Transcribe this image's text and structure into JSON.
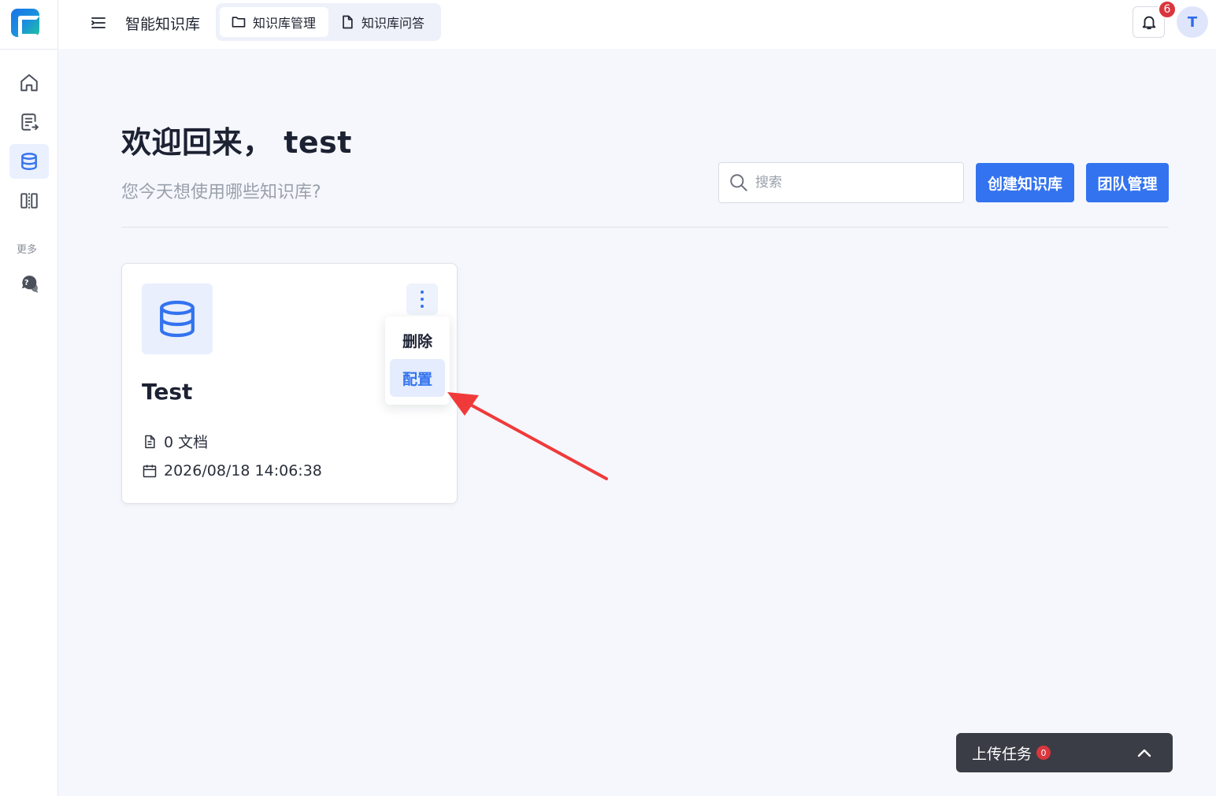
{
  "app": {
    "title": "智能知识库"
  },
  "header": {
    "tabs": [
      {
        "label": "知识库管理",
        "icon": "folder-icon",
        "active": true
      },
      {
        "label": "知识库问答",
        "icon": "file-icon",
        "active": false
      }
    ],
    "notifications": {
      "count": "6",
      "icon": "bell-icon"
    },
    "avatar": {
      "initial": "T"
    }
  },
  "sidebar": {
    "items": [
      {
        "name": "home",
        "icon": "home-icon",
        "active": false
      },
      {
        "name": "documents",
        "icon": "document-export-icon",
        "active": false
      },
      {
        "name": "knowledge-base",
        "icon": "database-icon",
        "active": true
      },
      {
        "name": "compare",
        "icon": "columns-icon",
        "active": false
      }
    ],
    "more_label": "更多",
    "more_items": [
      {
        "name": "help",
        "icon": "chat-question-icon"
      }
    ]
  },
  "main": {
    "welcome": "欢迎回来， test",
    "subtitle": "您今天想使用哪些知识库?",
    "search": {
      "placeholder": "搜索",
      "value": ""
    },
    "buttons": {
      "create": "创建知识库",
      "team": "团队管理"
    }
  },
  "cards": [
    {
      "title": "Test",
      "documents": "0 文档",
      "date": "2026/08/18 14:06:38",
      "menu": [
        {
          "label": "删除",
          "selected": false
        },
        {
          "label": "配置",
          "selected": true
        }
      ]
    }
  ],
  "upload": {
    "label": "上传任务",
    "count": "0"
  },
  "colors": {
    "primary": "#3373ef",
    "badge": "#d9363e",
    "annotation_arrow": "#f03a3a"
  }
}
